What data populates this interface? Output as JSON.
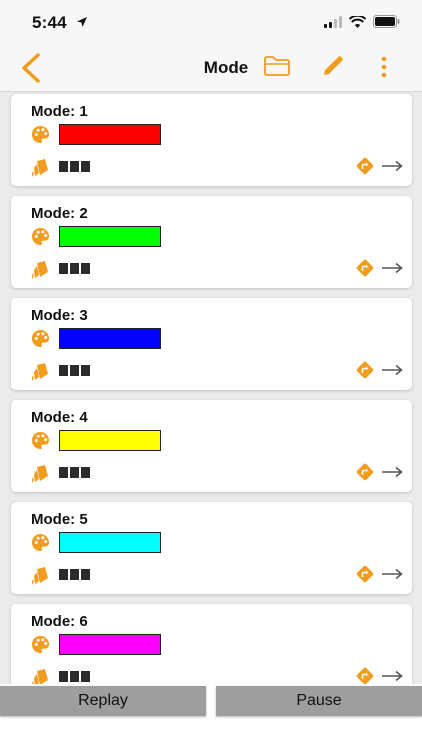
{
  "status": {
    "time": "5:44"
  },
  "nav": {
    "title": "Mode"
  },
  "colors": {
    "accent": "#f29c1f"
  },
  "modes": [
    {
      "title": "Mode: 1",
      "color": "#ff0000"
    },
    {
      "title": "Mode: 2",
      "color": "#00ff00"
    },
    {
      "title": "Mode: 3",
      "color": "#0000ff"
    },
    {
      "title": "Mode: 4",
      "color": "#ffff00"
    },
    {
      "title": "Mode: 5",
      "color": "#00ffff"
    },
    {
      "title": "Mode: 6",
      "color": "#ff00ff"
    }
  ],
  "footer": {
    "replay_label": "Replay",
    "pause_label": "Pause"
  },
  "icons": [
    "back-chevron-icon",
    "folder-icon",
    "pencil-icon",
    "more-vertical-icon",
    "palette-icon",
    "bucket-icon",
    "turn-right-icon",
    "arrow-right-icon"
  ]
}
